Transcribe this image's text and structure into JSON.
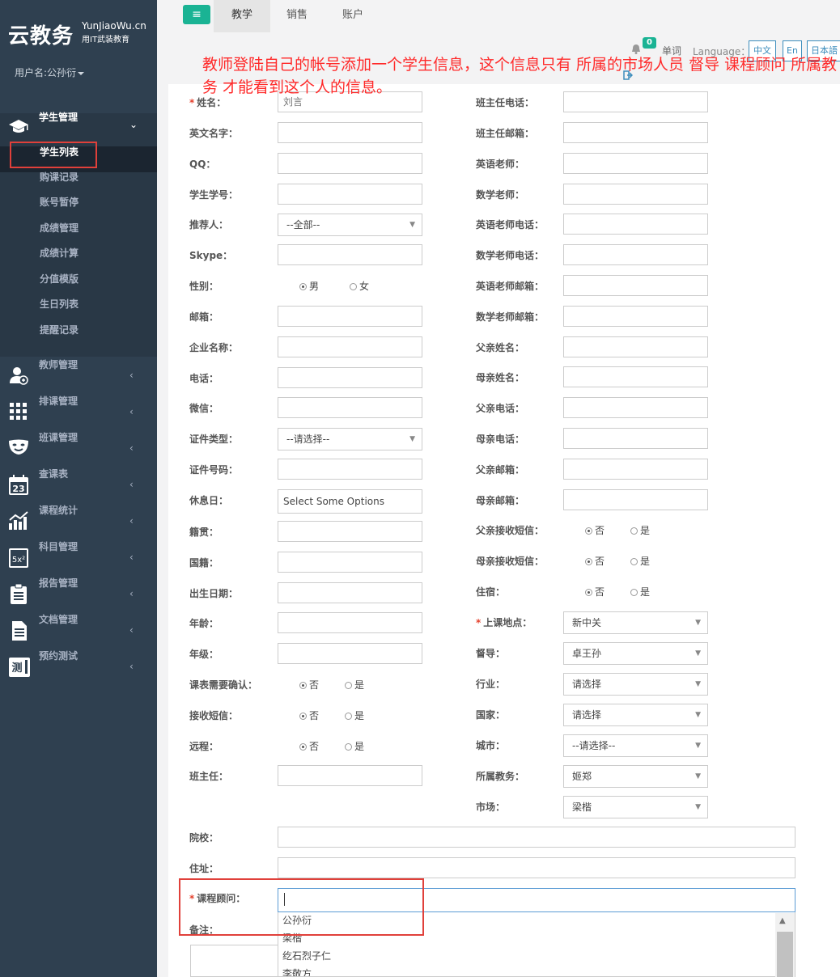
{
  "brand": {
    "logo": "云教务",
    "site": "YunJiaoWu.cn",
    "slogan": "用IT武装教育"
  },
  "user": {
    "label": "用户名:公孙衍"
  },
  "sidebar": {
    "student": {
      "label": "学生管理",
      "arrow": "⌄"
    },
    "sub_items": [
      "学生列表",
      "购课记录",
      "账号暂停",
      "成绩管理",
      "成绩计算",
      "分值模版",
      "生日列表",
      "提醒记录"
    ],
    "groups": [
      {
        "label": "教师管理",
        "icon": "teacher-icon"
      },
      {
        "label": "排课管理",
        "icon": "grid-icon"
      },
      {
        "label": "班课管理",
        "icon": "mask-icon"
      },
      {
        "label": "查课表",
        "icon": "calendar-icon"
      },
      {
        "label": "课程统计",
        "icon": "chart-icon"
      },
      {
        "label": "科目管理",
        "icon": "formula-icon"
      },
      {
        "label": "报告管理",
        "icon": "clipboard-icon"
      },
      {
        "label": "文档管理",
        "icon": "document-icon"
      },
      {
        "label": "预约测试",
        "icon": "test-icon"
      }
    ],
    "group_arrow": "‹",
    "calendar_day": "23"
  },
  "topbar": {
    "menu_icon": "≡",
    "tabs": [
      "教学",
      "销售",
      "账户"
    ],
    "badge": "0",
    "word": "单词",
    "language_label": "Language：",
    "languages": [
      "中文",
      "En",
      "日本語"
    ]
  },
  "annotation": "教师登陆自己的帐号添加一个学生信息，这个信息只有 所属的市场人员 督导 课程顾问 所属教务 才能看到这个人的信息。",
  "form": {
    "left": {
      "name_label": "姓名：",
      "name_value": "刘言",
      "english_name": "英文名字：",
      "qq": "QQ：",
      "student_no": "学生学号：",
      "referrer": "推荐人：",
      "referrer_value": "--全部--",
      "skype": "Skype：",
      "gender": "性别：",
      "male": "男",
      "female": "女",
      "email": "邮箱：",
      "company": "企业名称：",
      "phone": "电话：",
      "wechat": "微信：",
      "id_type": "证件类型：",
      "id_type_value": "--请选择--",
      "id_no": "证件号码：",
      "rest_day": "休息日：",
      "rest_day_placeholder": "Select Some Options",
      "native": "籍贯：",
      "nationality": "国籍：",
      "birthday": "出生日期：",
      "age": "年龄：",
      "grade": "年级：",
      "schedule_confirm": "课表需要确认：",
      "receive_sms": "接收短信：",
      "remote": "远程：",
      "head_teacher": "班主任："
    },
    "right": {
      "ht_phone": "班主任电话：",
      "ht_email": "班主任邮箱：",
      "en_teacher": "英语老师：",
      "math_teacher": "数学老师：",
      "en_teacher_phone": "英语老师电话：",
      "math_teacher_phone": "数学老师电话：",
      "en_teacher_email": "英语老师邮箱：",
      "math_teacher_email": "数学老师邮箱：",
      "father_name": "父亲姓名：",
      "mother_name": "母亲姓名：",
      "father_phone": "父亲电话：",
      "mother_phone": "母亲电话：",
      "father_email": "父亲邮箱：",
      "mother_email": "母亲邮箱：",
      "father_sms": "父亲接收短信：",
      "mother_sms": "母亲接收短信：",
      "boarding": "住宿：",
      "location": "上课地点：",
      "location_value": "新中关",
      "supervisor": "督导：",
      "supervisor_value": "卓王孙",
      "industry": "行业：",
      "industry_value": "请选择",
      "country": "国家：",
      "country_value": "请选择",
      "city": "城市：",
      "city_value": "--请选择--",
      "academic": "所属教务：",
      "academic_value": "姬郑",
      "market": "市场：",
      "market_value": "梁楷"
    },
    "no": "否",
    "yes": "是",
    "school": "院校：",
    "address": "住址：",
    "advisor": "课程顾问：",
    "remark": "备注：",
    "advisor_options": [
      "公孙衍",
      "梁楷",
      "纥石烈子仁",
      "李敬方"
    ]
  }
}
